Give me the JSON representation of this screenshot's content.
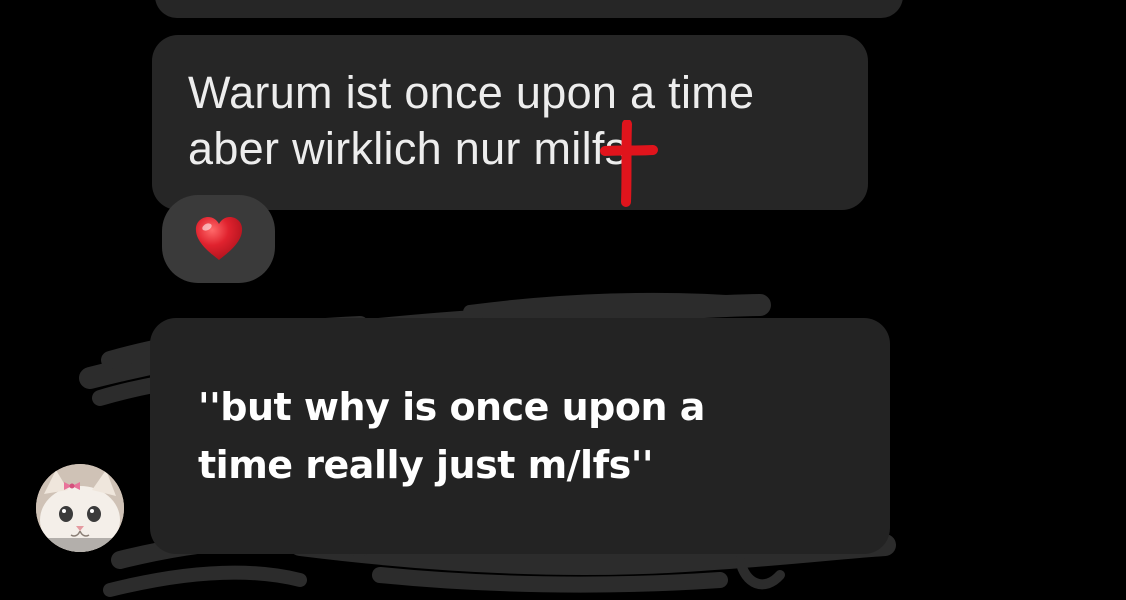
{
  "conversation": {
    "previous_message": {
      "text": ""
    },
    "received_message": {
      "text": "Warum ist once upon a time\naber wirklich nur milfs",
      "redaction_mark": "red-cross-icon"
    },
    "reaction": {
      "emoji": "❤️",
      "icon": "red-heart-icon"
    }
  },
  "caption_overlay": {
    "text": "''but why is once upon a\ntime really just m/lfs''"
  },
  "sender": {
    "avatar_icon": "kitten-with-bow-avatar"
  },
  "colors": {
    "background": "#000000",
    "bubble": "#262626",
    "caption_bubble": "#232323",
    "reaction_pill": "#3a3a3a",
    "scribble": "#2e2e2e",
    "cross": "#e0141c",
    "heart": "#e0222e"
  }
}
